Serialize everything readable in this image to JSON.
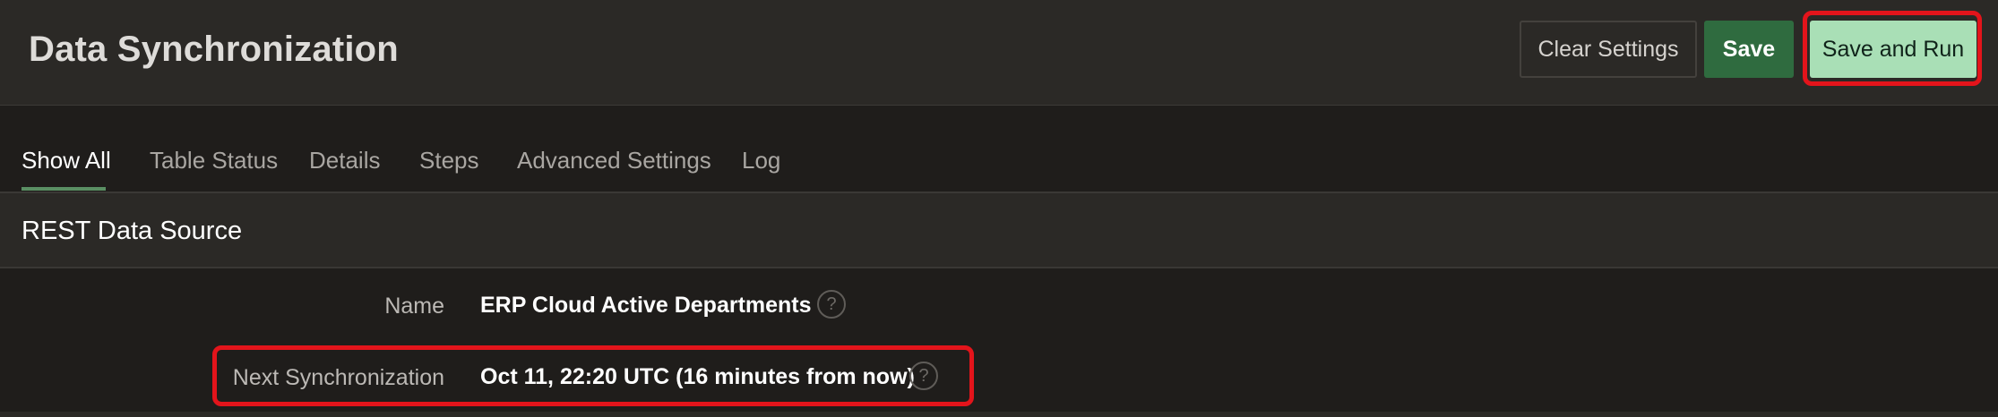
{
  "header": {
    "title": "Data Synchronization",
    "buttons": {
      "clear": "Clear Settings",
      "save": "Save",
      "save_and_run": "Save and Run"
    }
  },
  "tabs": [
    {
      "label": "Show All",
      "active": true
    },
    {
      "label": "Table Status",
      "active": false
    },
    {
      "label": "Details",
      "active": false
    },
    {
      "label": "Steps",
      "active": false
    },
    {
      "label": "Advanced Settings",
      "active": false
    },
    {
      "label": "Log",
      "active": false
    }
  ],
  "region": {
    "title": "REST Data Source",
    "fields": [
      {
        "label": "Name",
        "value": "ERP Cloud Active Departments",
        "help_icon": "help-circle-icon"
      },
      {
        "label": "Next Synchronization",
        "value": "Oct 11, 22:20 UTC (16 minutes from now)",
        "help_icon": "help-circle-icon"
      }
    ]
  },
  "icons": {
    "help_glyph": "?"
  },
  "colors": {
    "background": "#1f1d1b",
    "header_bg": "#2b2926",
    "primary_button": "#2f6b3f",
    "hot_button": "#a9dfb6",
    "active_tab_underline": "#5a8f63",
    "annotation_highlight": "#e3141b"
  }
}
